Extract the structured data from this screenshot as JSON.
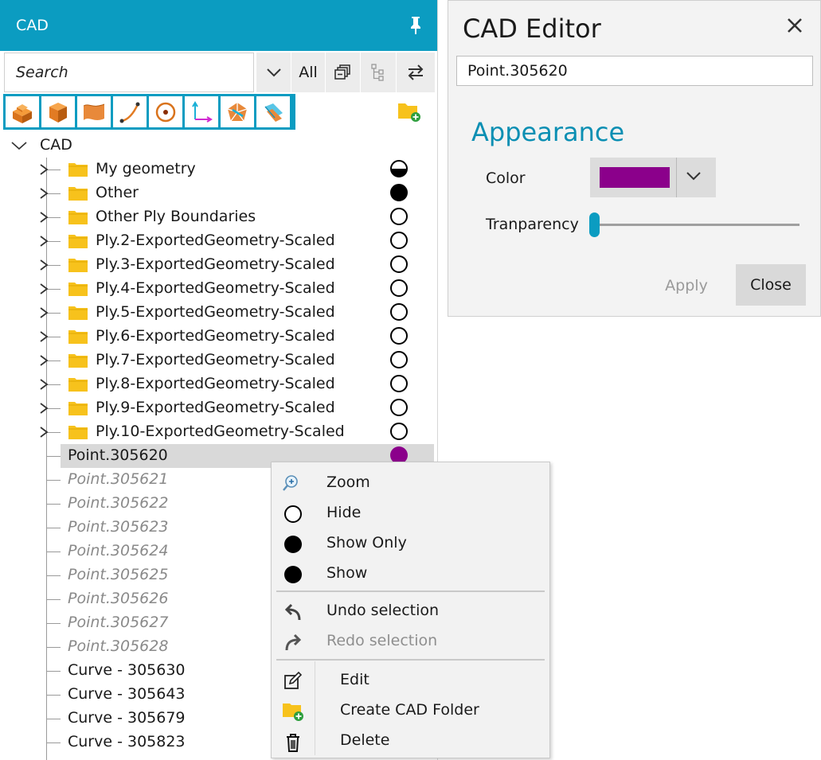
{
  "cad_panel": {
    "title": "CAD",
    "search_placeholder": "Search",
    "filter_all_label": "All",
    "tree": {
      "root_label": "CAD",
      "folders": [
        {
          "label": "My geometry",
          "visibility": "half"
        },
        {
          "label": "Other",
          "visibility": "full"
        },
        {
          "label": "Other Ply Boundaries",
          "visibility": "empty"
        },
        {
          "label": "Ply.2-ExportedGeometry-Scaled",
          "visibility": "empty"
        },
        {
          "label": "Ply.3-ExportedGeometry-Scaled",
          "visibility": "empty"
        },
        {
          "label": "Ply.4-ExportedGeometry-Scaled",
          "visibility": "empty"
        },
        {
          "label": "Ply.5-ExportedGeometry-Scaled",
          "visibility": "empty"
        },
        {
          "label": "Ply.6-ExportedGeometry-Scaled",
          "visibility": "empty"
        },
        {
          "label": "Ply.7-ExportedGeometry-Scaled",
          "visibility": "empty"
        },
        {
          "label": "Ply.8-ExportedGeometry-Scaled",
          "visibility": "empty"
        },
        {
          "label": "Ply.9-ExportedGeometry-Scaled",
          "visibility": "empty"
        },
        {
          "label": "Ply.10-ExportedGeometry-Scaled",
          "visibility": "empty"
        }
      ],
      "items": [
        {
          "label": "Point.305620",
          "selected": true,
          "dim": false,
          "visibility": "magenta"
        },
        {
          "label": "Point.305621",
          "dim": true
        },
        {
          "label": "Point.305622",
          "dim": true
        },
        {
          "label": "Point.305623",
          "dim": true
        },
        {
          "label": "Point.305624",
          "dim": true
        },
        {
          "label": "Point.305625",
          "dim": true
        },
        {
          "label": "Point.305626",
          "dim": true
        },
        {
          "label": "Point.305627",
          "dim": true
        },
        {
          "label": "Point.305628",
          "dim": true
        },
        {
          "label": "Curve - 305630",
          "dim": false
        },
        {
          "label": "Curve - 305643",
          "dim": false
        },
        {
          "label": "Curve - 305679",
          "dim": false
        },
        {
          "label": "Curve - 305823",
          "dim": false
        }
      ]
    },
    "colors": {
      "header": "#0b9cc1",
      "folder": "#f7c21c",
      "selected_point": "#8b008b"
    }
  },
  "cad_editor": {
    "title": "CAD Editor",
    "name_value": "Point.305620",
    "section_heading": "Appearance",
    "color_label": "Color",
    "color_value": "#8b008b",
    "transparency_label": "Tranparency",
    "transparency_value": 0,
    "apply_label": "Apply",
    "close_label": "Close"
  },
  "context_menu": {
    "items": [
      {
        "label": "Zoom",
        "icon": "zoom-icon"
      },
      {
        "label": "Hide",
        "icon": "circle-outline-icon"
      },
      {
        "label": "Show Only",
        "icon": "circle-filled-icon"
      },
      {
        "label": "Show",
        "icon": "circle-filled-icon"
      },
      {
        "label": "Undo selection",
        "icon": "undo-icon"
      },
      {
        "label": "Redo selection",
        "icon": "redo-icon",
        "disabled": true
      },
      {
        "label": "Edit",
        "icon": "edit-icon"
      },
      {
        "label": "Create CAD Folder",
        "icon": "create-folder-icon"
      },
      {
        "label": "Delete",
        "icon": "trash-icon"
      }
    ]
  }
}
